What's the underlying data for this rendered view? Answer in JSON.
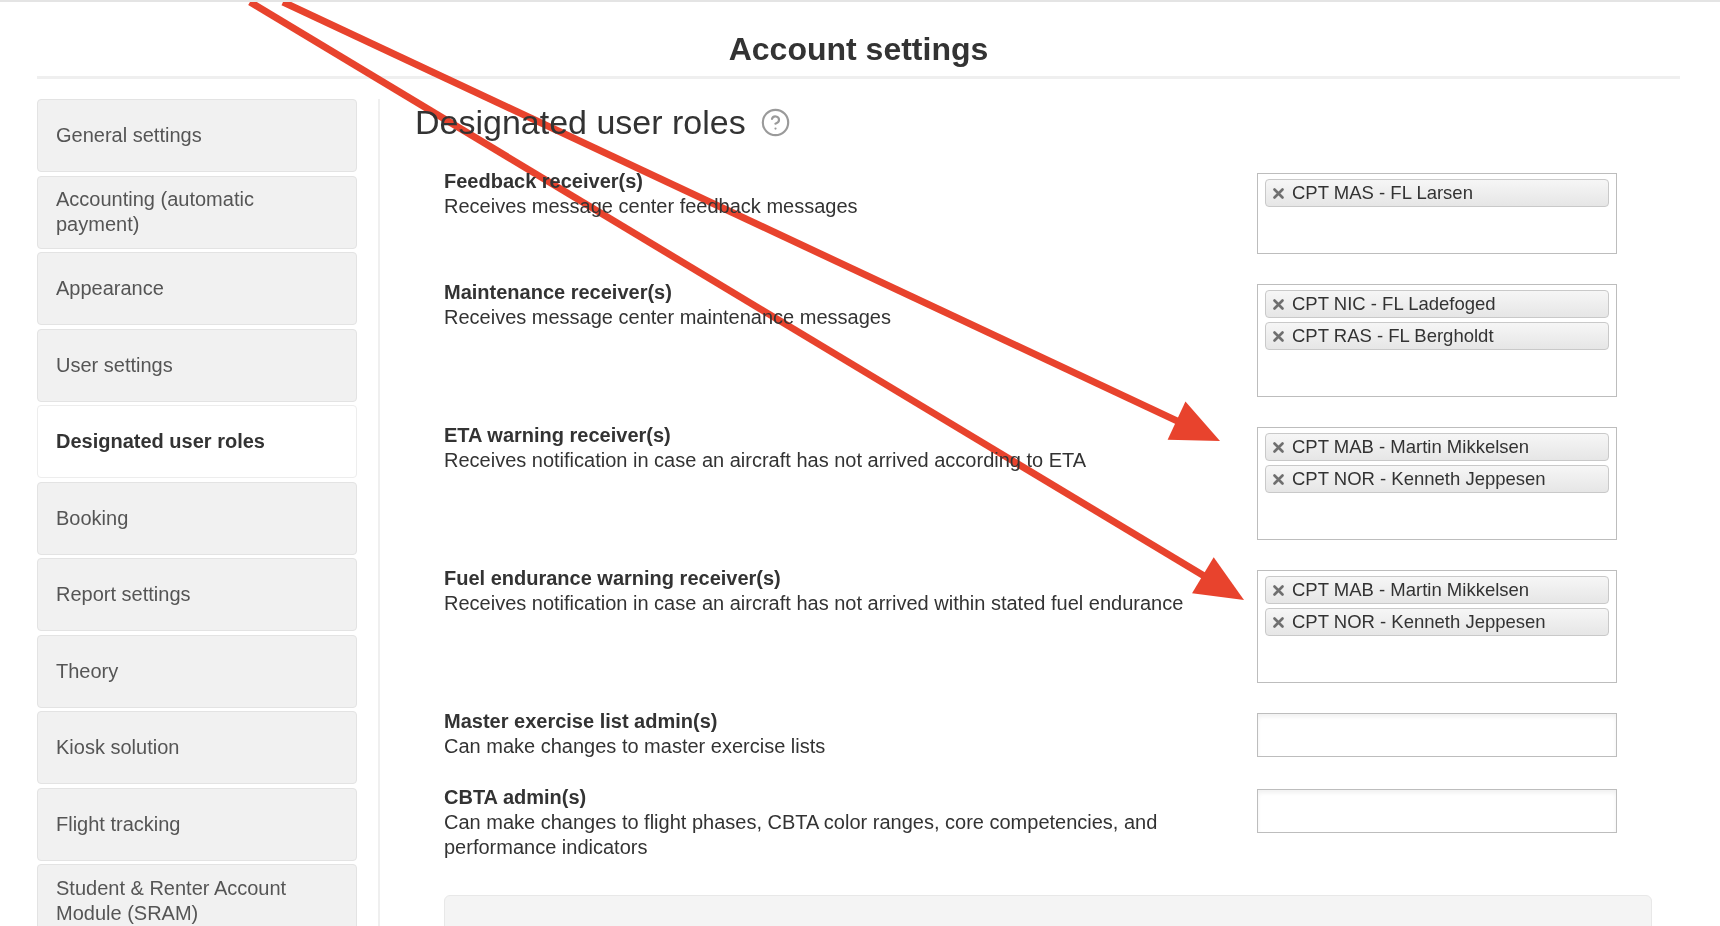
{
  "page_title": "Account settings",
  "sidebar": {
    "items": [
      {
        "label": "General settings",
        "selected": false
      },
      {
        "label": "Accounting (automatic payment)",
        "selected": false
      },
      {
        "label": "Appearance",
        "selected": false
      },
      {
        "label": "User settings",
        "selected": false
      },
      {
        "label": "Designated user roles",
        "selected": true
      },
      {
        "label": "Booking",
        "selected": false
      },
      {
        "label": "Report settings",
        "selected": false
      },
      {
        "label": "Theory",
        "selected": false
      },
      {
        "label": "Kiosk solution",
        "selected": false
      },
      {
        "label": "Flight tracking",
        "selected": false
      },
      {
        "label": "Student & Renter Account Module (SRAM)",
        "selected": false
      }
    ]
  },
  "section": {
    "title": "Designated user roles",
    "roles": [
      {
        "label": "Feedback receiver(s)",
        "description": "Receives message center feedback messages",
        "assigned": [
          "CPT MAS - FL Larsen"
        ],
        "annotated": false
      },
      {
        "label": "Maintenance receiver(s)",
        "description": "Receives message center maintenance messages",
        "assigned": [
          "CPT NIC - FL Ladefoged",
          "CPT RAS - FL Bergholdt"
        ],
        "annotated": false
      },
      {
        "label": "ETA warning receiver(s)",
        "description": "Receives notification in case an aircraft has not arrived according to ETA",
        "assigned": [
          "CPT MAB - Martin Mikkelsen",
          "CPT NOR - Kenneth Jeppesen"
        ],
        "annotated": true
      },
      {
        "label": "Fuel endurance warning receiver(s)",
        "description": "Receives notification in case an aircraft has not arrived within stated fuel endurance",
        "assigned": [
          "CPT MAB - Martin Mikkelsen",
          "CPT NOR - Kenneth Jeppesen"
        ],
        "annotated": true
      },
      {
        "label": "Master exercise list admin(s)",
        "description": "Can make changes to master exercise lists",
        "annotated": false
      },
      {
        "label": "CBTA admin(s)",
        "description": "Can make changes to flight phases, CBTA color ranges, core competencies, and performance indicators",
        "annotated": false
      }
    ]
  }
}
